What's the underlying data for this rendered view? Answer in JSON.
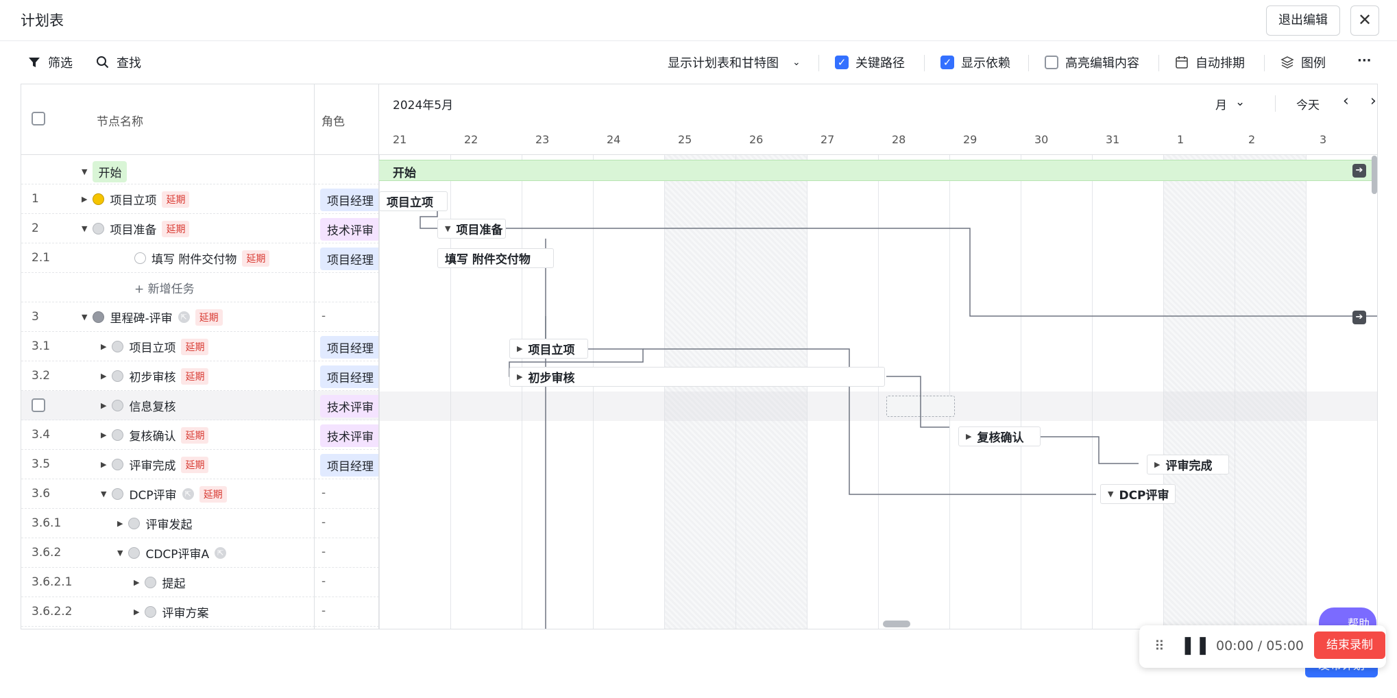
{
  "window": {
    "title": "计划表",
    "exit_label": "退出编辑",
    "close_label": "✕"
  },
  "toolbar": {
    "filter_label": "筛选",
    "find_label": "查找",
    "view_select": "显示计划表和甘特图",
    "critical_path": {
      "label": "关键路径",
      "checked": true
    },
    "show_deps": {
      "label": "显示依赖",
      "checked": true
    },
    "highlight_edit": {
      "label": "高亮编辑内容",
      "checked": false
    },
    "auto_schedule_label": "自动排期",
    "legend_label": "图例",
    "more_label": "···"
  },
  "table": {
    "col_name": "节点名称",
    "col_role": "角色",
    "rows": [
      {
        "num": "",
        "name": "开始",
        "state": "start",
        "delay": "",
        "role": "",
        "role_type": ""
      },
      {
        "num": "1",
        "name": "项目立项",
        "state": "yellow",
        "delay": "延期",
        "role": "项目经理",
        "role_type": "pm"
      },
      {
        "num": "2",
        "name": "项目准备",
        "state": "gray",
        "delay": "延期",
        "role": "技术评审",
        "role_type": "tech"
      },
      {
        "num": "2.1",
        "name": "填写 附件交付物",
        "state": "white",
        "delay": "延期",
        "role": "项目经理",
        "role_type": "pm"
      },
      {
        "num": "",
        "name": "+ 新增任务",
        "state": "add",
        "delay": "",
        "role": "",
        "role_type": ""
      },
      {
        "num": "3",
        "name": "里程碑-评审",
        "state": "flag",
        "delay": "延期",
        "role": "-",
        "role_type": "dash"
      },
      {
        "num": "3.1",
        "name": "项目立项",
        "state": "gray",
        "delay": "延期",
        "role": "项目经理",
        "role_type": "pm"
      },
      {
        "num": "3.2",
        "name": "初步审核",
        "state": "gray",
        "delay": "延期",
        "role": "项目经理",
        "role_type": "pm"
      },
      {
        "num": "",
        "name": "信息复核",
        "state": "gray",
        "delay": "",
        "role": "技术评审",
        "role_type": "tech"
      },
      {
        "num": "3.4",
        "name": "复核确认",
        "state": "gray",
        "delay": "延期",
        "role": "技术评审",
        "role_type": "tech"
      },
      {
        "num": "3.5",
        "name": "评审完成",
        "state": "gray",
        "delay": "延期",
        "role": "项目经理",
        "role_type": "pm"
      },
      {
        "num": "3.6",
        "name": "DCP评审",
        "state": "gray",
        "delay": "延期",
        "role": "-",
        "role_type": "dash"
      },
      {
        "num": "3.6.1",
        "name": "评审发起",
        "state": "gray",
        "delay": "",
        "role": "-",
        "role_type": "dash"
      },
      {
        "num": "3.6.2",
        "name": "CDCP评审A",
        "state": "gray",
        "delay": "",
        "role": "-",
        "role_type": "dash"
      },
      {
        "num": "3.6.2.1",
        "name": "提起",
        "state": "gray",
        "delay": "",
        "role": "-",
        "role_type": "dash"
      },
      {
        "num": "3.6.2.2",
        "name": "评审方案",
        "state": "gray",
        "delay": "",
        "role": "-",
        "role_type": "dash"
      }
    ]
  },
  "gantt": {
    "month_label": "2024年5月",
    "scale_label": "月",
    "today_label": "今天",
    "days": [
      "21",
      "22",
      "23",
      "24",
      "25",
      "26",
      "27",
      "28",
      "29",
      "30",
      "31",
      "1",
      "2",
      "3"
    ],
    "bars": {
      "start": "开始",
      "b1": "项目立项",
      "b2": "项目准备",
      "b21": "填写 附件交付物",
      "b31": "项目立项",
      "b32": "初步审核",
      "b34": "复核确认",
      "b35": "评审完成",
      "b36": "DCP评审"
    }
  },
  "recorder": {
    "time": "00:00 / 05:00",
    "end_label": "结束录制"
  },
  "help_label": "帮助",
  "publish_label": "发布计划",
  "colors": {
    "accent": "#3370ff",
    "start_green": "#d9f5d6",
    "delay_red": "#d83931"
  }
}
